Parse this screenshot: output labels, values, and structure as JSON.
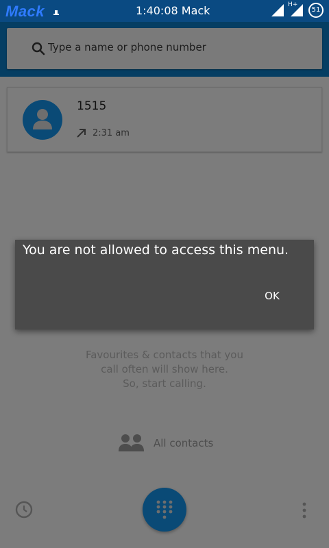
{
  "status_bar": {
    "carrier": "Mack",
    "clock": "1:40:08 Mack",
    "network_type": "H+",
    "battery_level": "51",
    "icons": [
      "notification-icon",
      "signal-icon",
      "signal-icon",
      "battery-icon"
    ]
  },
  "search": {
    "placeholder": "Type a name or phone number",
    "icon": "search-icon"
  },
  "recent_call": {
    "number": "1515",
    "direction_icon": "outgoing-call-icon",
    "time": "2:31 am",
    "avatar_icon": "person-icon"
  },
  "empty_state": {
    "line1": "Favourites & contacts that you",
    "line2": "call often will show here.",
    "line3": "So, start calling."
  },
  "all_contacts": {
    "label": "All contacts",
    "icon": "contacts-icon"
  },
  "bottom_bar": {
    "history_icon": "history-icon",
    "dialpad_icon": "dialpad-icon",
    "overflow_icon": "more-vert-icon"
  },
  "dialog": {
    "message": "You are not allowed to access this menu.",
    "ok_label": "OK"
  },
  "colors": {
    "status_bar": "#0a4a82",
    "header": "#053e63",
    "accent": "#0a4a76",
    "dialog": "#4a4a4a",
    "scrim_background": "#7c7c7c"
  }
}
